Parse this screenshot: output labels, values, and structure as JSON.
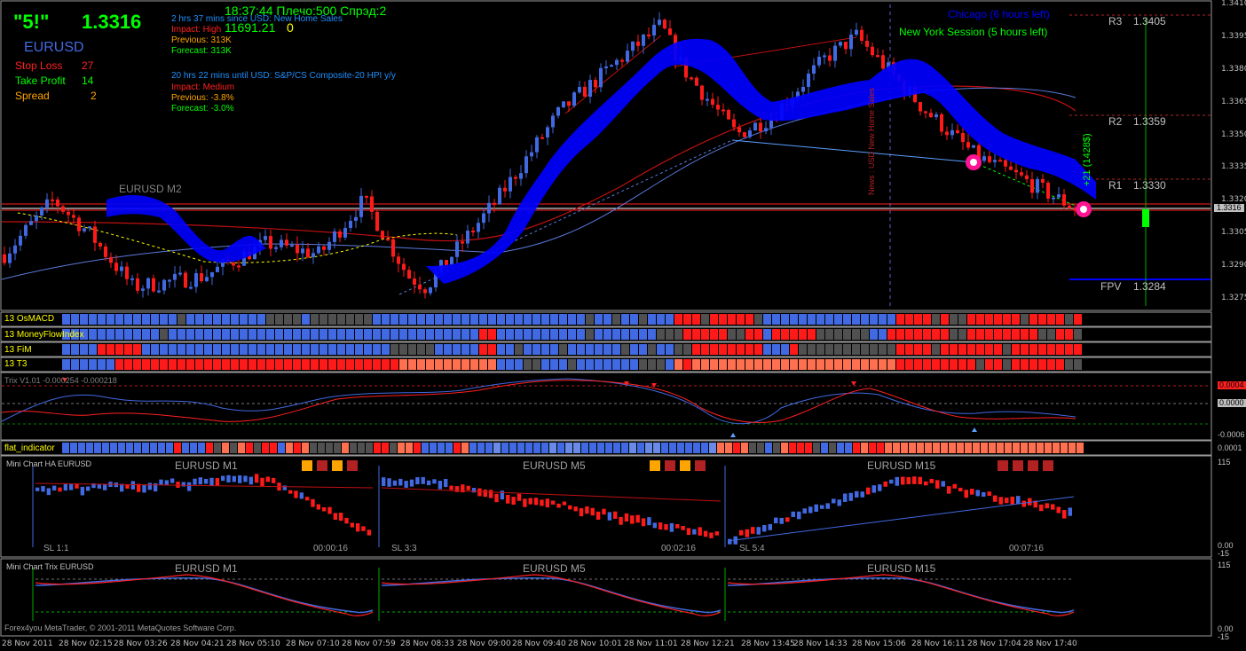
{
  "header": {
    "rating": "\"5!\"",
    "price": "1.3316",
    "symbol": "EURUSD",
    "clock_line": "18:37:44 Плечо:500 Спрэд:2",
    "balance": "11691.21",
    "balance_suffix": "0"
  },
  "trade_info": {
    "stop_loss_label": "Stop Loss",
    "stop_loss_value": "27",
    "take_profit_label": "Take Profit",
    "take_profit_value": "14",
    "spread_label": "Spread",
    "spread_value": "2"
  },
  "news": [
    {
      "line1": "2 hrs 37 mins since USD: New Home Sales",
      "impact": "Impact: High",
      "previous": "Previous: 313K",
      "forecast": "Forecast: 313K"
    },
    {
      "line1": "20 hrs 22 mins until USD: S&P/CS Composite-20 HPI y/y",
      "impact": "Impact: Medium",
      "previous": "Previous: -3.8%",
      "forecast": "Forecast: -3.0%"
    }
  ],
  "sessions": {
    "chicago": "Chicago (6 hours left)",
    "new_york": "New York Session (5 hours left)"
  },
  "main_chart": {
    "watermark": "EURUSD M2",
    "news_vertical": "News : USD New Home Sales",
    "pips_label": "+21 (1428$)",
    "pivots": [
      {
        "label": "R3",
        "value": "1.3405"
      },
      {
        "label": "R2",
        "value": "1.3359"
      },
      {
        "label": "R1",
        "value": "1.3330"
      },
      {
        "label": "FPV",
        "value": "1.3284"
      }
    ],
    "price_axis": [
      "1.3410",
      "1.3395",
      "1.3380",
      "1.3365",
      "1.3350",
      "1.3335",
      "1.3320",
      "1.3305",
      "1.3290",
      "1.3275"
    ],
    "current_price_tag": "1.3316",
    "colors": {
      "bull": "#4169e1",
      "bear": "#ff1a1a",
      "cloud": "#0000ff"
    }
  },
  "strips": [
    {
      "label": "13 OsMACD"
    },
    {
      "label": "13 MoneyFlowIndex"
    },
    {
      "label": "13 FiM"
    },
    {
      "label": "13 T3"
    }
  ],
  "trix": {
    "label": "Trix V1.01 -0.000254 -0.000218",
    "axis": [
      "0.0004",
      "0.0000",
      "-0.0006"
    ]
  },
  "flat": {
    "label": "flat_indicator",
    "axis": "0.0001"
  },
  "mini_ha": {
    "label": "Mini Chart HA EURUSD",
    "panels": [
      {
        "title": "EURUSD M1",
        "sl": "SL 1:1",
        "time": "00:00:16"
      },
      {
        "title": "EURUSD M5",
        "sl": "SL 3:3",
        "time": "00:02:16"
      },
      {
        "title": "EURUSD M15",
        "sl": "SL 5:4",
        "time": "00:07:16"
      }
    ],
    "axis": [
      "115",
      "0.00",
      "-15"
    ]
  },
  "mini_trix": {
    "label": "Mini Chart Trix EURUSD",
    "panels": [
      {
        "title": "EURUSD M1"
      },
      {
        "title": "EURUSD M5"
      },
      {
        "title": "EURUSD M15"
      }
    ],
    "axis": [
      "115",
      "0.00",
      "-15"
    ]
  },
  "copyright": "Forex4you MetaTrader, © 2001-2011 MetaQuotes Software Corp.",
  "time_axis": [
    "28 Nov 2011",
    "28 Nov 02:15",
    "28 Nov 03:26",
    "28 Nov 04:21",
    "28 Nov 05:10",
    "28 Nov 07:10",
    "28 Nov 07:59",
    "28 Nov 08:33",
    "28 Nov 09:00",
    "28 Nov 09:40",
    "28 Nov 10:01",
    "28 Nov 11:01",
    "28 Nov 12:21",
    "28 Nov 13:45",
    "28 Nov 14:33",
    "28 Nov 15:06",
    "28 Nov 16:11",
    "28 Nov 17:04",
    "28 Nov 17:40"
  ]
}
